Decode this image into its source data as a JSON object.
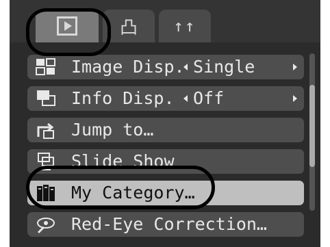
{
  "tabs": {
    "play_icon": "play-icon",
    "print_icon": "print-icon",
    "print_glyph": "凸",
    "setup_icon": "settings-icon",
    "setup_glyph": "↑↑"
  },
  "menu": {
    "items": [
      {
        "label": "Image Disp.",
        "value": "Single",
        "icon": "image-display-icon"
      },
      {
        "label": "Info Disp.",
        "value": "Off",
        "icon": "info-display-icon"
      },
      {
        "label": "Jump to…",
        "icon": "jump-icon"
      },
      {
        "label": "Slide Show",
        "icon": "slideshow-icon"
      },
      {
        "label": "My Category…",
        "icon": "my-category-icon",
        "selected": true
      },
      {
        "label": "Red-Eye Correction…",
        "icon": "red-eye-icon"
      }
    ]
  },
  "colors": {
    "screen_bg": "#2b2b2b",
    "row_bg": "#4e4e4e",
    "selected_row_bg": "#bfbfbf",
    "text": "#e8e8e8",
    "active_tab": "#7a7a7a",
    "highlight_ring": "#000000"
  }
}
